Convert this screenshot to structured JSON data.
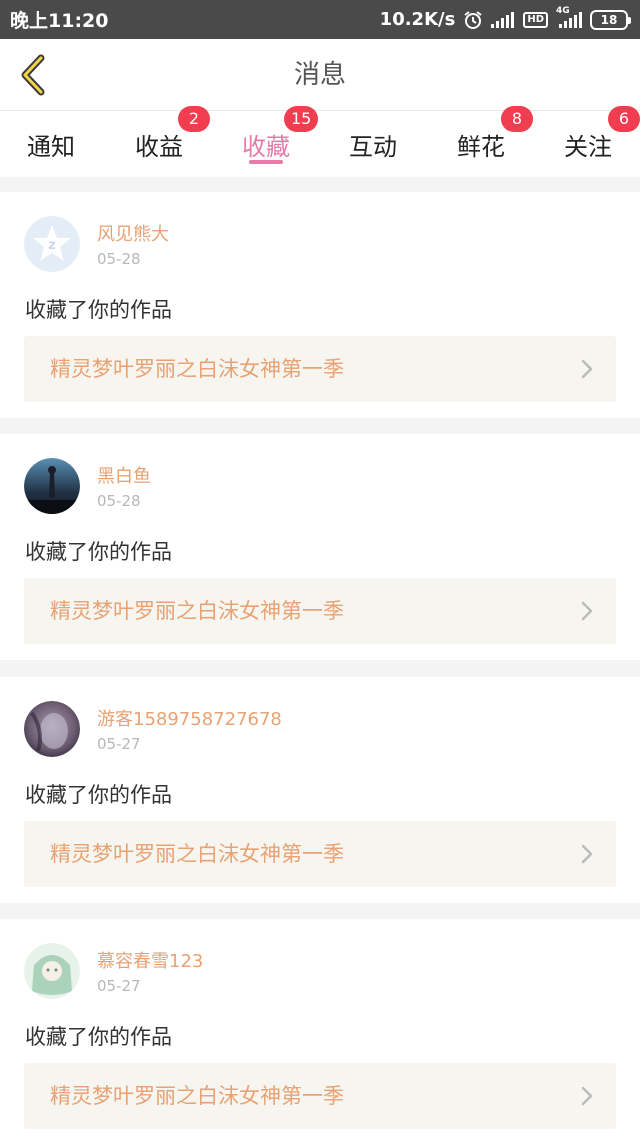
{
  "status_bar": {
    "time": "晚上11:20",
    "net_speed": "10.2K/s",
    "hd": "HD",
    "net_type": "4G",
    "battery": "18"
  },
  "header": {
    "title": "消息"
  },
  "tabs": [
    {
      "label": "通知",
      "badge": null
    },
    {
      "label": "收益",
      "badge": "2"
    },
    {
      "label": "收藏",
      "badge": "15"
    },
    {
      "label": "互动",
      "badge": null
    },
    {
      "label": "鲜花",
      "badge": "8"
    },
    {
      "label": "关注",
      "badge": "6"
    }
  ],
  "active_tab": "收藏",
  "items": [
    {
      "user": "风见熊大",
      "date": "05-28",
      "action": "收藏了你的作品",
      "work": "精灵梦叶罗丽之白沫女神第一季"
    },
    {
      "user": "黑白鱼",
      "date": "05-28",
      "action": "收藏了你的作品",
      "work": "精灵梦叶罗丽之白沫女神第一季"
    },
    {
      "user": "游客1589758727678",
      "date": "05-27",
      "action": "收藏了你的作品",
      "work": "精灵梦叶罗丽之白沫女神第一季"
    },
    {
      "user": "慕容春雪123",
      "date": "05-27",
      "action": "收藏了你的作品",
      "work": "精灵梦叶罗丽之白沫女神第一季"
    }
  ],
  "colors": {
    "accent": "#e57ba8",
    "badge": "#f03d4f",
    "username": "#e8a273",
    "work_bg": "#f6f5ef"
  }
}
